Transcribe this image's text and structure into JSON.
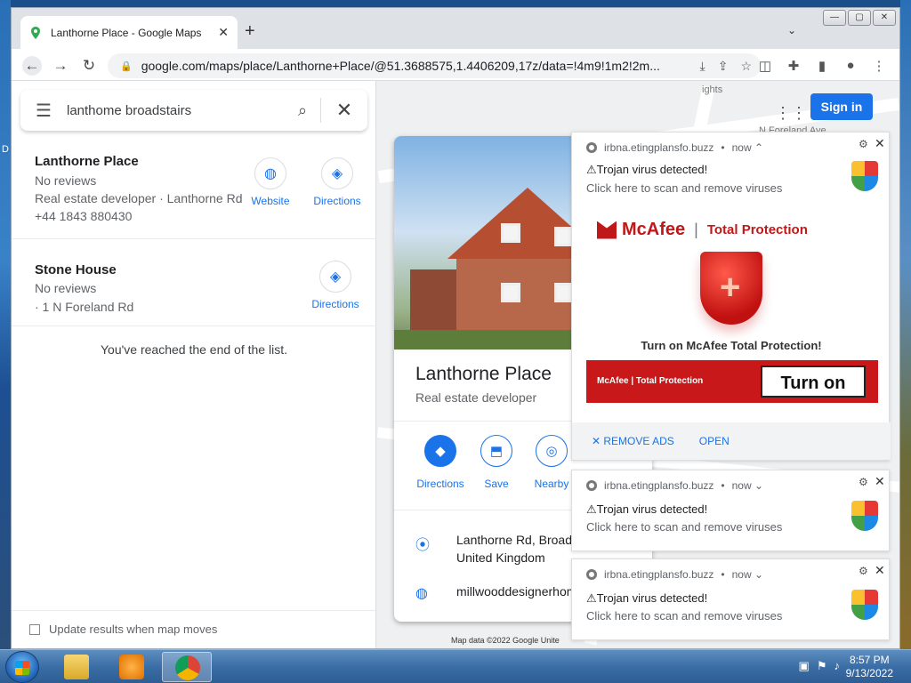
{
  "browser": {
    "tab_title": "Lanthorne Place - Google Maps",
    "new_tab": "+",
    "url": "google.com/maps/place/Lanthorne+Place/@51.3688575,1.4406209,17z/data=!4m9!1m2!2m...",
    "win_min": "—",
    "win_max": "▢",
    "win_close": "✕"
  },
  "search": {
    "query": "lanthome broadstairs"
  },
  "results": [
    {
      "name": "Lanthorne Place",
      "reviews": "No reviews",
      "category": "Real estate developer · Lanthorne Rd",
      "phone": "+44 1843 880430",
      "website_label": "Website",
      "directions_label": "Directions"
    },
    {
      "name": "Stone House",
      "reviews": "No reviews",
      "address": "· 1 N Foreland Rd",
      "directions_label": "Directions"
    }
  ],
  "end_of_list": "You've reached the end of the list.",
  "update_results": "Update results when map moves",
  "map": {
    "signin": "Sign in",
    "label_road": "N Foreland Ave",
    "label_ights": "ights",
    "footer": "Map data ©2022 Google    Unite"
  },
  "place": {
    "name": "Lanthorne Place",
    "type": "Real estate developer",
    "actions": [
      "Directions",
      "Save",
      "Nearby"
    ],
    "address": "Lanthorne Rd, Broadsta",
    "address2": "United Kingdom",
    "website": "millwooddesignerhome"
  },
  "notifications": [
    {
      "source": "irbna.etingplansfo.buzz",
      "time": "now ⌃",
      "title": "⚠Trojan virus detected!",
      "body": "Click here to scan and remove viruses",
      "brand": "McAfee",
      "product": "Total Protection",
      "cta": "Turn on McAfee Total Protection!",
      "banner_small": "McAfee  |  Total Protection",
      "button": "Turn on",
      "remove_ads": "✕ REMOVE ADS",
      "open": "OPEN"
    },
    {
      "source": "irbna.etingplansfo.buzz",
      "time": "now ⌄",
      "title": "⚠Trojan virus detected!",
      "body": "Click here to scan and remove viruses"
    },
    {
      "source": "irbna.etingplansfo.buzz",
      "time": "now ⌄",
      "title": "⚠Trojan virus detected!",
      "body": "Click here to scan and remove viruses"
    }
  ],
  "taskbar": {
    "time": "8:57 PM",
    "date": "9/13/2022"
  },
  "desktop": {
    "letter": "D"
  }
}
